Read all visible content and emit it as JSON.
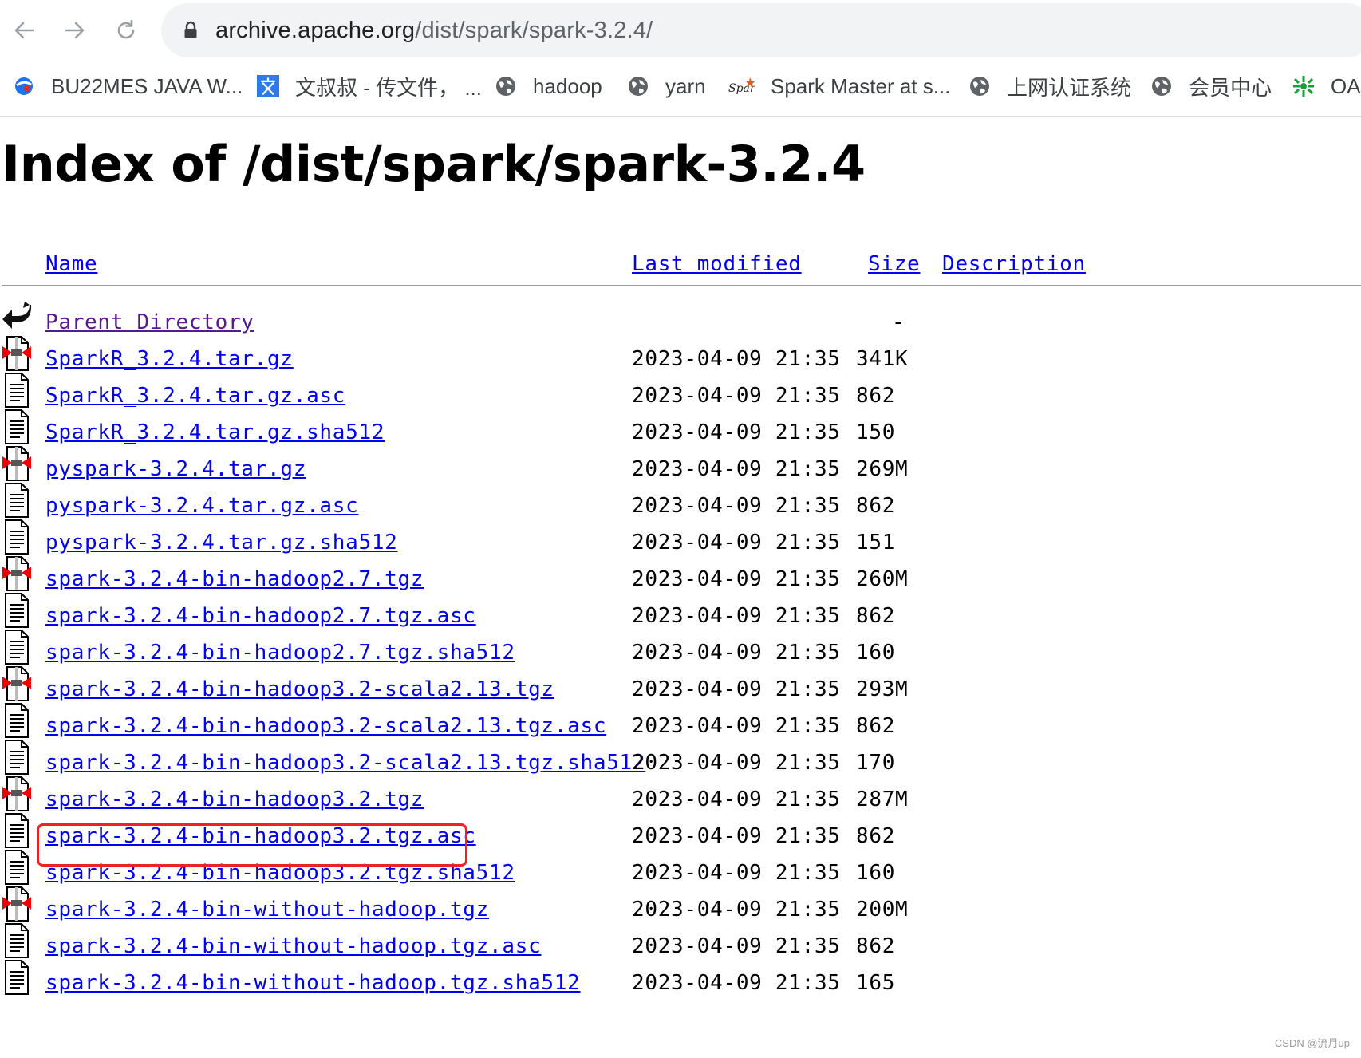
{
  "browser": {
    "url_host": "archive.apache.org",
    "url_path": "/dist/spark/spark-3.2.4/",
    "bookmarks": [
      {
        "label": "BU22MES JAVA W...",
        "icon": "bookmark-blue-icon"
      },
      {
        "label": "文叔叔 - 传文件， ...",
        "icon": "wenshushu-icon"
      },
      {
        "label": "hadoop",
        "icon": "globe-icon"
      },
      {
        "label": "yarn",
        "icon": "globe-icon"
      },
      {
        "label": "Spark Master at s...",
        "icon": "spark-logo-icon"
      },
      {
        "label": "上网认证系统",
        "icon": "globe-icon"
      },
      {
        "label": "会员中心",
        "icon": "globe-icon"
      },
      {
        "label": "OA",
        "icon": "oa-icon"
      }
    ]
  },
  "page": {
    "title": "Index of /dist/spark/spark-3.2.4",
    "columns": {
      "name": "Name",
      "last_modified": "Last modified",
      "size": "Size",
      "description": "Description"
    },
    "rows": [
      {
        "name": "Parent Directory",
        "date": "",
        "size": "-",
        "icon": "back-icon"
      },
      {
        "name": "SparkR_3.2.4.tar.gz",
        "date": "2023-04-09 21:35",
        "size": "341K",
        "icon": "compressed-icon"
      },
      {
        "name": "SparkR_3.2.4.tar.gz.asc",
        "date": "2023-04-09 21:35",
        "size": "862",
        "icon": "text-file-icon"
      },
      {
        "name": "SparkR_3.2.4.tar.gz.sha512",
        "date": "2023-04-09 21:35",
        "size": "150",
        "icon": "text-file-icon"
      },
      {
        "name": "pyspark-3.2.4.tar.gz",
        "date": "2023-04-09 21:35",
        "size": "269M",
        "icon": "compressed-icon"
      },
      {
        "name": "pyspark-3.2.4.tar.gz.asc",
        "date": "2023-04-09 21:35",
        "size": "862",
        "icon": "text-file-icon"
      },
      {
        "name": "pyspark-3.2.4.tar.gz.sha512",
        "date": "2023-04-09 21:35",
        "size": "151",
        "icon": "text-file-icon"
      },
      {
        "name": "spark-3.2.4-bin-hadoop2.7.tgz",
        "date": "2023-04-09 21:35",
        "size": "260M",
        "icon": "compressed-icon"
      },
      {
        "name": "spark-3.2.4-bin-hadoop2.7.tgz.asc",
        "date": "2023-04-09 21:35",
        "size": "862",
        "icon": "text-file-icon"
      },
      {
        "name": "spark-3.2.4-bin-hadoop2.7.tgz.sha512",
        "date": "2023-04-09 21:35",
        "size": "160",
        "icon": "text-file-icon"
      },
      {
        "name": "spark-3.2.4-bin-hadoop3.2-scala2.13.tgz",
        "date": "2023-04-09 21:35",
        "size": "293M",
        "icon": "compressed-icon"
      },
      {
        "name": "spark-3.2.4-bin-hadoop3.2-scala2.13.tgz.asc",
        "date": "2023-04-09 21:35",
        "size": "862",
        "icon": "text-file-icon"
      },
      {
        "name": "spark-3.2.4-bin-hadoop3.2-scala2.13.tgz.sha512",
        "date": "2023-04-09 21:35",
        "size": "170",
        "icon": "text-file-icon"
      },
      {
        "name": "spark-3.2.4-bin-hadoop3.2.tgz",
        "date": "2023-04-09 21:35",
        "size": "287M",
        "icon": "compressed-icon"
      },
      {
        "name": "spark-3.2.4-bin-hadoop3.2.tgz.asc",
        "date": "2023-04-09 21:35",
        "size": "862",
        "icon": "text-file-icon"
      },
      {
        "name": "spark-3.2.4-bin-hadoop3.2.tgz.sha512",
        "date": "2023-04-09 21:35",
        "size": "160",
        "icon": "text-file-icon"
      },
      {
        "name": "spark-3.2.4-bin-without-hadoop.tgz",
        "date": "2023-04-09 21:35",
        "size": "200M",
        "icon": "compressed-icon"
      },
      {
        "name": "spark-3.2.4-bin-without-hadoop.tgz.asc",
        "date": "2023-04-09 21:35",
        "size": "862",
        "icon": "text-file-icon"
      },
      {
        "name": "spark-3.2.4-bin-without-hadoop.tgz.sha512",
        "date": "2023-04-09 21:35",
        "size": "165",
        "icon": "text-file-icon"
      }
    ]
  },
  "annotation": {
    "highlight_color": "#e8232a"
  },
  "watermark": "CSDN @流月up",
  "colors": {
    "link": "#0000ee",
    "visited": "#551a8b",
    "omnibox_bg": "#f1f3f4"
  }
}
